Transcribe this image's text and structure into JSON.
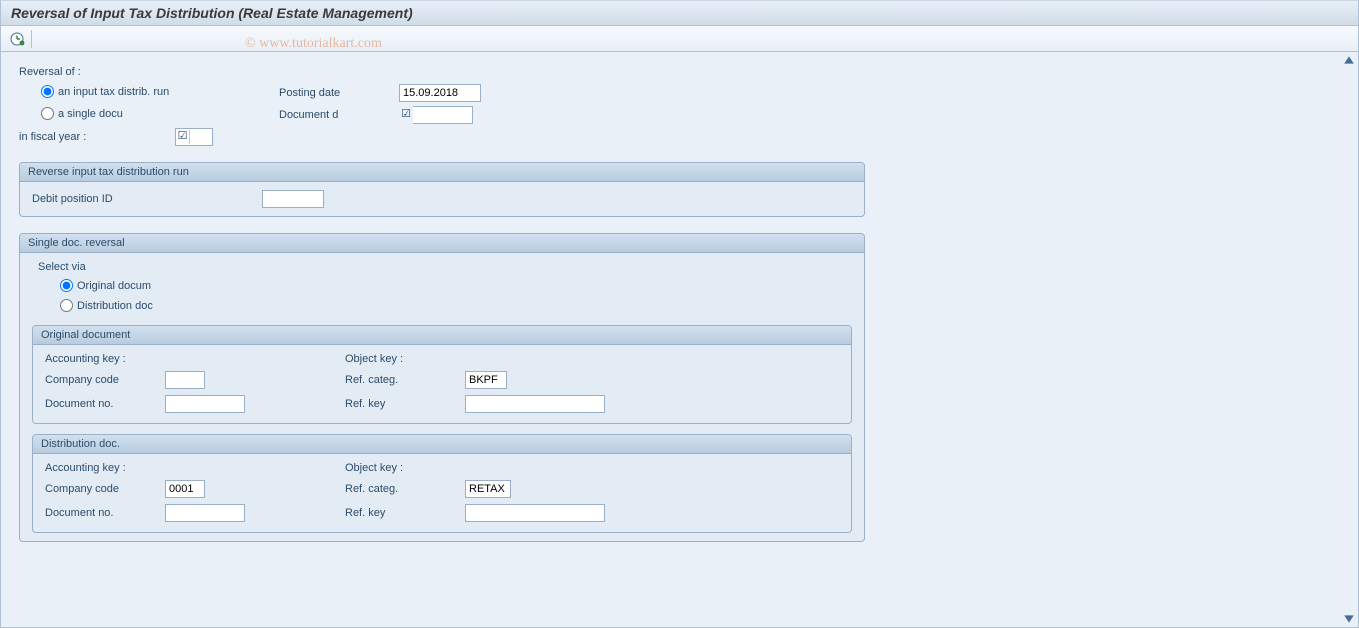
{
  "header": {
    "title": "Reversal of Input Tax Distribution (Real Estate Management)"
  },
  "watermark": "© www.tutorialkart.com",
  "top_section": {
    "label": "Reversal of  :",
    "radio1": "an input tax distrib. run",
    "radio2": "a single docu",
    "fiscal_label": "in fiscal year :",
    "fiscal_value": "",
    "posting_label": "Posting date",
    "posting_value": "15.09.2018",
    "doc_label": "Document d",
    "doc_value": ""
  },
  "group_reverse": {
    "title": "Reverse input tax distribution run",
    "field1_label": "Debit position ID",
    "field1_value": ""
  },
  "group_single": {
    "title": "Single doc. reversal",
    "select_via": "Select via",
    "radio1": "Original docum",
    "radio2": "Distribution doc",
    "orig": {
      "title": "Original document",
      "acc_key": "Accounting key :",
      "obj_key": "Object key :",
      "company_code_label": "Company code",
      "company_code_value": "",
      "ref_categ_label": "Ref. categ.",
      "ref_categ_value": "BKPF",
      "doc_no_label": "Document no.",
      "doc_no_value": "",
      "ref_key_label": "Ref. key",
      "ref_key_value": ""
    },
    "dist": {
      "title": "Distribution doc.",
      "acc_key": "Accounting key :",
      "obj_key": "Object key :",
      "company_code_label": "Company code",
      "company_code_value": "0001",
      "ref_categ_label": "Ref. categ.",
      "ref_categ_value": "RETAX",
      "doc_no_label": "Document no.",
      "doc_no_value": "",
      "ref_key_label": "Ref. key",
      "ref_key_value": ""
    }
  }
}
